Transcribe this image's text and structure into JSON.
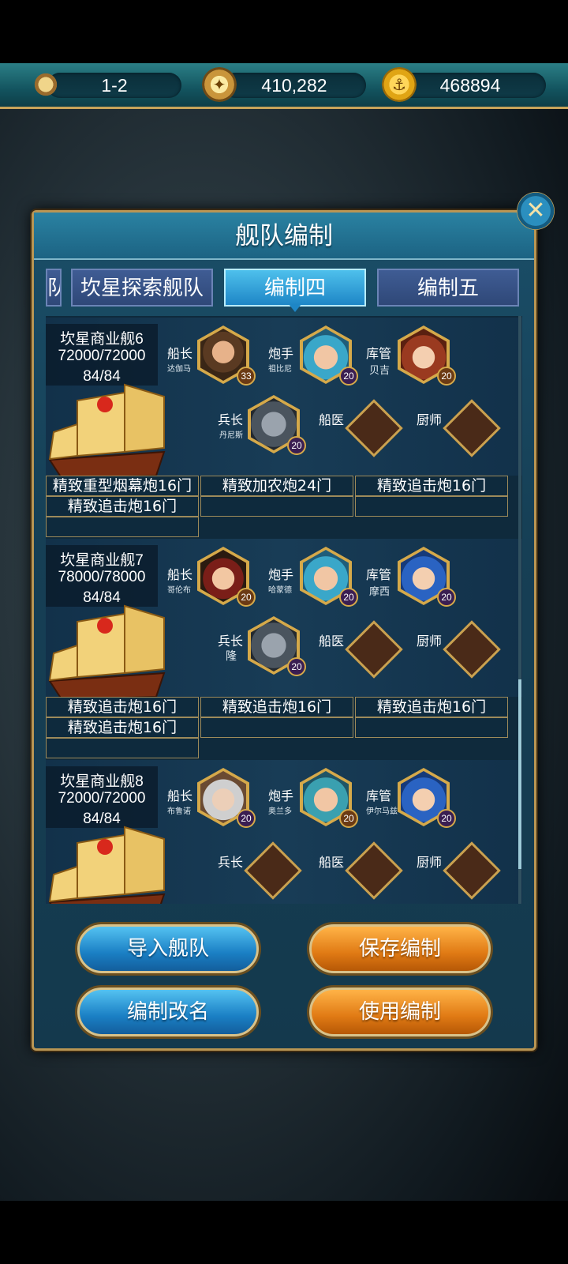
{
  "topbar": {
    "stage": "1-2",
    "silver": "410,282",
    "gold": "468894",
    "icons": [
      "hourglass-icon",
      "compass-icon",
      "anchor-coin-icon"
    ]
  },
  "panel": {
    "title": "舰队编制",
    "close_icon": "close-icon"
  },
  "tabs": [
    {
      "label": "队",
      "active": false
    },
    {
      "label": "坎星探索舰队",
      "active": false
    },
    {
      "label": "编制四",
      "active": true
    },
    {
      "label": "编制五",
      "active": false
    }
  ],
  "roles": {
    "captain": "船长",
    "gunner": "炮手",
    "storekeeper": "库管",
    "marine": "兵长",
    "doctor": "船医",
    "chef": "厨师"
  },
  "ships": [
    {
      "name": "坎星商业舰6",
      "durability": "72000/72000",
      "crew": "84/84",
      "captain": {
        "name": "达伽马",
        "level": "33"
      },
      "gunner": {
        "name": "祖比尼",
        "level": "20"
      },
      "storekeeper": {
        "name": "贝吉",
        "level": "20"
      },
      "marine": {
        "name": "丹尼斯",
        "level": "20"
      },
      "equipment": [
        "精致重型烟幕炮16门",
        "精致加农炮24门",
        "精致追击炮16门",
        "精致追击炮16门",
        "",
        "",
        ""
      ]
    },
    {
      "name": "坎星商业舰7",
      "durability": "78000/78000",
      "crew": "84/84",
      "captain": {
        "name": "哥伦布",
        "level": "20"
      },
      "gunner": {
        "name": "哈蒙德",
        "level": "20"
      },
      "storekeeper": {
        "name": "摩西",
        "level": "20"
      },
      "marine": {
        "name": "隆",
        "level": "20"
      },
      "equipment": [
        "精致追击炮16门",
        "精致追击炮16门",
        "精致追击炮16门",
        "精致追击炮16门",
        "",
        "",
        ""
      ]
    },
    {
      "name": "坎星商业舰8",
      "durability": "72000/72000",
      "crew": "84/84",
      "captain": {
        "name": "布鲁诺",
        "level": "20"
      },
      "gunner": {
        "name": "奥兰多",
        "level": "20"
      },
      "storekeeper": {
        "name": "伊尔马兹",
        "level": "20"
      }
    }
  ],
  "buttons": {
    "import": "导入舰队",
    "save": "保存编制",
    "rename": "编制改名",
    "use": "使用编制"
  },
  "colors": {
    "accent_gold": "#c8a45a",
    "panel_blue": "#1a4e68",
    "tab_active": "#1e86c6",
    "button_orange": "#e07a14"
  }
}
